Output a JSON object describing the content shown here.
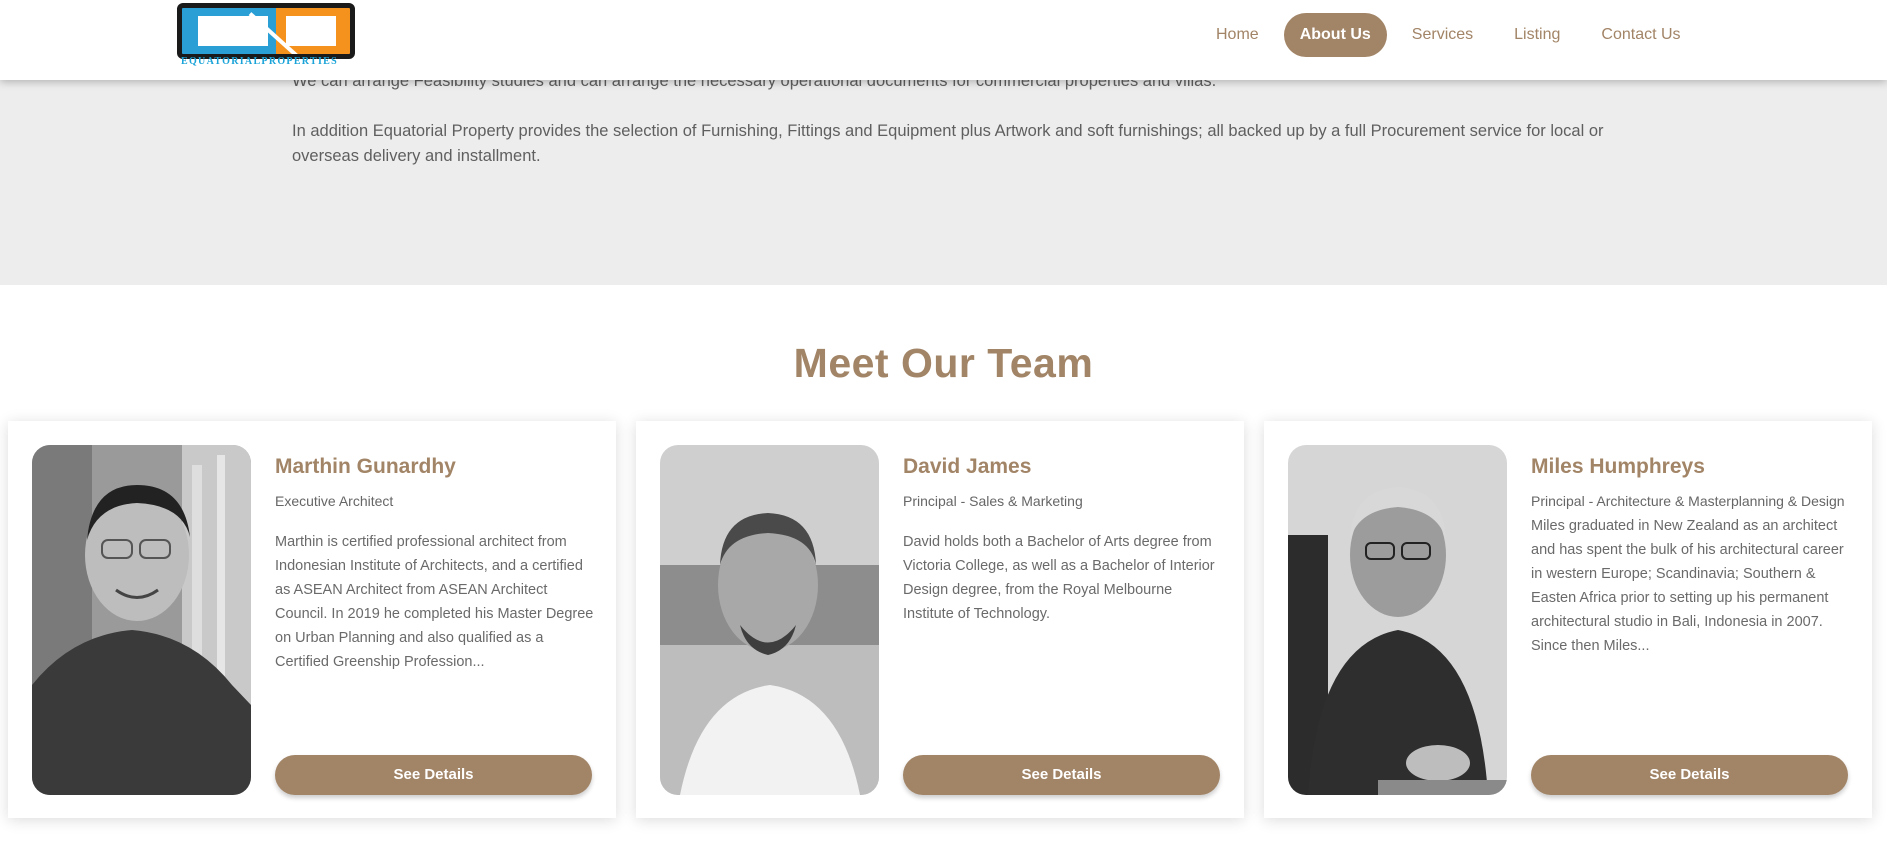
{
  "header": {
    "logo_text": "EQUATORIALPROPERTIES",
    "nav": [
      {
        "label": "Home",
        "active": false
      },
      {
        "label": "About Us",
        "active": true
      },
      {
        "label": "Services",
        "active": false
      },
      {
        "label": "Listing",
        "active": false
      },
      {
        "label": "Contact Us",
        "active": false
      }
    ]
  },
  "intro": {
    "line1": "We can arrange Feasibility studies and can arrange the necessary operational documents for commercial properties and villas.",
    "para2": "In addition Equatorial Property provides the selection of Furnishing, Fittings and Equipment plus Artwork and soft furnishings; all backed up by a full Procurement service for local or overseas delivery and installment."
  },
  "team": {
    "title": "Meet Our Team",
    "members": [
      {
        "name": "Marthin Gunardhy",
        "role": "Executive Architect",
        "bio": "Marthin is certified professional architect from Indonesian Institute of Architects, and a certified as ASEAN Architect from ASEAN Architect Council. In 2019 he completed his Master Degree on Urban Planning and also qualified as a Certified Greenship Profession...",
        "button": "See Details"
      },
      {
        "name": "David James",
        "role": "Principal - Sales & Marketing",
        "bio": "David holds both a Bachelor of Arts degree from Victoria College, as well as a Bachelor of Interior Design degree, from the Royal Melbourne Institute of Technology.",
        "button": "See Details"
      },
      {
        "name": "Miles Humphreys",
        "role": "Principal - Architecture & Masterplanning & Design",
        "bio": "Miles graduated in New Zealand as an architect and has spent the bulk of his architectural career in western Europe; Scandinavia; Southern & Easten Africa prior to setting up his permanent architectural studio in Bali, Indonesia in 2007. Since then Miles...",
        "button": "See Details"
      }
    ]
  },
  "colors": {
    "accent": "#a28466",
    "band": "#ededed",
    "logo_blue": "#2a9fd6",
    "logo_orange": "#f5921e"
  }
}
